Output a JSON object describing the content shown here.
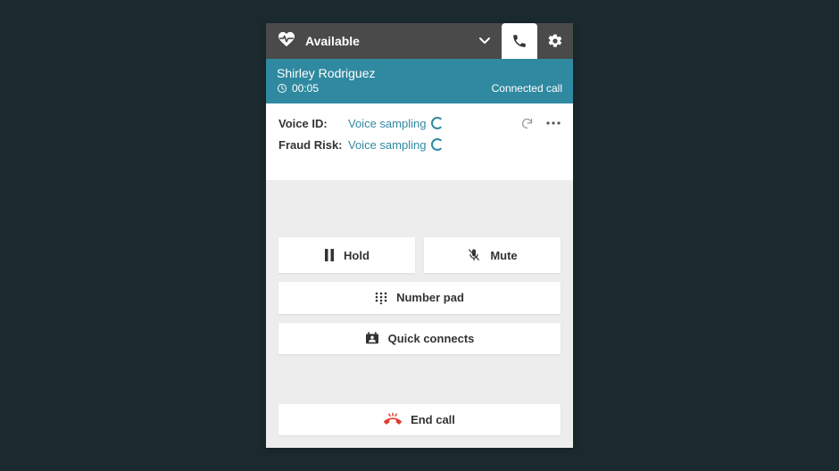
{
  "topbar": {
    "status": "Available"
  },
  "caller": {
    "name": "Shirley Rodriguez",
    "timer": "00:05",
    "status": "Connected call"
  },
  "voice": {
    "voice_id_label": "Voice ID:",
    "voice_id_value": "Voice sampling",
    "fraud_risk_label": "Fraud Risk:",
    "fraud_risk_value": "Voice sampling"
  },
  "buttons": {
    "hold": "Hold",
    "mute": "Mute",
    "number_pad": "Number pad",
    "quick_connects": "Quick connects",
    "end_call": "End call"
  },
  "colors": {
    "accent": "#2f89a0",
    "end_call": "#e23b2e"
  }
}
